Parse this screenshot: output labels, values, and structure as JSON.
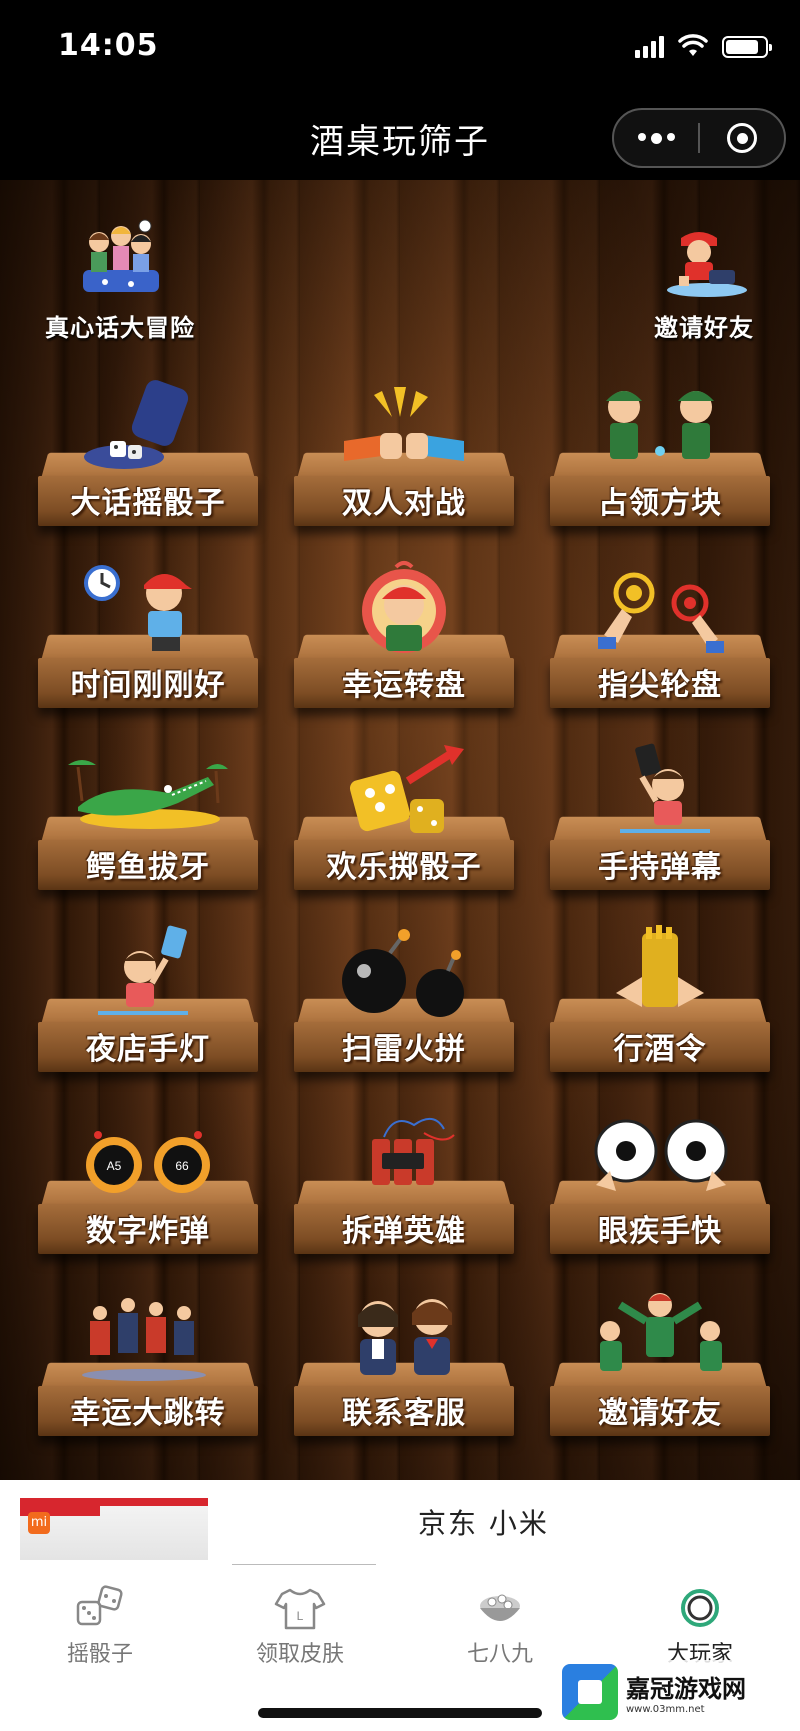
{
  "status_bar": {
    "time": "14:05",
    "battery_level": 0.85
  },
  "nav": {
    "title": "酒桌玩筛子"
  },
  "top_links": [
    {
      "label": "真心话大冒险",
      "icon": "friends-table-icon"
    },
    {
      "label": "邀请好友",
      "icon": "kneeling-boy-icon"
    }
  ],
  "games": [
    {
      "label": "大话摇骰子",
      "icon": "dice-cup-icon"
    },
    {
      "label": "双人对战",
      "icon": "fist-bump-icon"
    },
    {
      "label": "占领方块",
      "icon": "soldiers-icon"
    },
    {
      "label": "时间刚刚好",
      "icon": "alarm-clock-icon"
    },
    {
      "label": "幸运转盘",
      "icon": "lucky-wheel-icon"
    },
    {
      "label": "指尖轮盘",
      "icon": "fingertip-touch-icon"
    },
    {
      "label": "鳄鱼拔牙",
      "icon": "crocodile-icon"
    },
    {
      "label": "欢乐掷骰子",
      "icon": "golden-dice-icon"
    },
    {
      "label": "手持弹幕",
      "icon": "phone-scroll-icon"
    },
    {
      "label": "夜店手灯",
      "icon": "phone-light-icon"
    },
    {
      "label": "扫雷火拼",
      "icon": "bombs-icon"
    },
    {
      "label": "行酒令",
      "icon": "wine-order-icon"
    },
    {
      "label": "数字炸弹",
      "icon": "number-bombs-icon"
    },
    {
      "label": "拆弹英雄",
      "icon": "dynamite-icon"
    },
    {
      "label": "眼疾手快",
      "icon": "big-eyes-icon"
    },
    {
      "label": "幸运大跳转",
      "icon": "dancers-icon"
    },
    {
      "label": "联系客服",
      "icon": "customer-service-icon"
    },
    {
      "label": "邀请好友",
      "icon": "invite-dancers-icon"
    }
  ],
  "ad": {
    "text": "京东 小米",
    "thumb_badge": "mi"
  },
  "tabs": [
    {
      "label": "摇骰子",
      "icon": "dice-icon",
      "active": false
    },
    {
      "label": "领取皮肤",
      "icon": "shirt-icon",
      "active": false
    },
    {
      "label": "七八九",
      "icon": "bowl-icon",
      "active": false
    },
    {
      "label": "大玩家",
      "icon": "ring-icon",
      "active": true
    }
  ],
  "watermark": {
    "main": "嘉冠游戏网",
    "sub": "www.03mm.net"
  },
  "colors": {
    "wood_dark": "#3a1d0a",
    "board": "#a56d3b",
    "ad_red": "#d7262e"
  }
}
